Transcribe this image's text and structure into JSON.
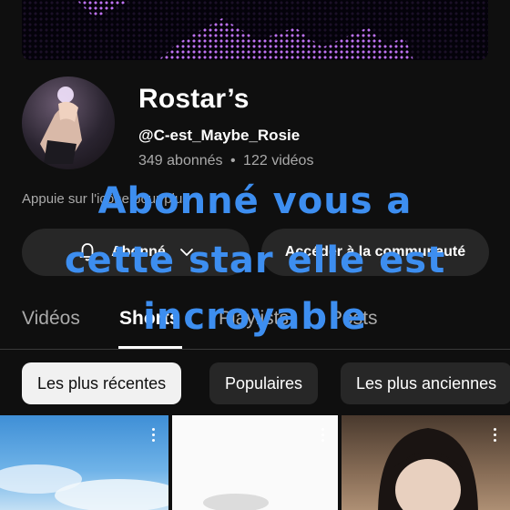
{
  "channel": {
    "name": "Rostar’s",
    "handle": "@C-est_Maybe_Rosie",
    "subscribers": "349 abonnés",
    "separator": "•",
    "videos": "122 vidéos",
    "description": "Appuie sur l'icône pour plus"
  },
  "buttons": {
    "subscribe_label": "Abonné",
    "community_label": "Accéder à la communauté"
  },
  "tabs": [
    {
      "label": "Vidéos",
      "active": false
    },
    {
      "label": "Shorts",
      "active": true
    },
    {
      "label": "Playlists",
      "active": false
    },
    {
      "label": "Posts",
      "active": false
    }
  ],
  "filters": [
    {
      "label": "Les plus récentes",
      "selected": true
    },
    {
      "label": "Populaires",
      "selected": false
    },
    {
      "label": "Les plus anciennes",
      "selected": false
    }
  ],
  "overlay_caption": {
    "line1": "Abonné  vous a",
    "line2": "cette star elle est",
    "line3": "incroyable"
  },
  "colors": {
    "background": "#0f0f0f",
    "caption": "#3d8ef0",
    "banner_glow": "#c878ff"
  },
  "icons": [
    "bell-icon",
    "chevron-down-icon",
    "more-vert-icon"
  ]
}
